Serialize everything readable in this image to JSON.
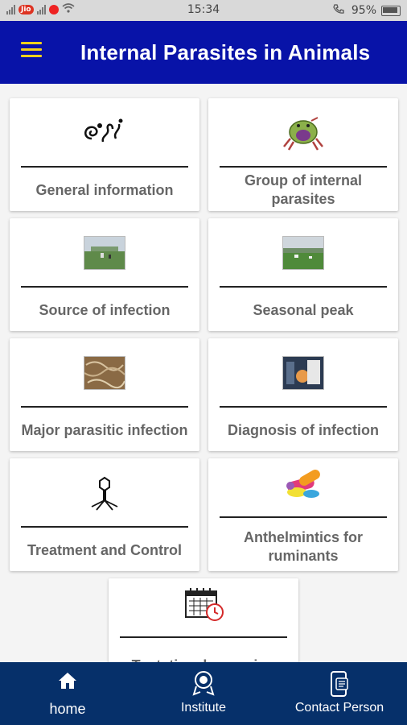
{
  "status_bar": {
    "carrier": "Jio",
    "time": "15:34",
    "battery": "95%"
  },
  "app_bar": {
    "title": "Internal Parasites in Animals",
    "menu_icon": "hamburger-menu-icon"
  },
  "menu": {
    "items": [
      {
        "label": "General information",
        "icon": "parasite-worm-icon"
      },
      {
        "label": "Group of internal parasites",
        "icon": "parasite-creature-icon"
      },
      {
        "label": "Source of infection",
        "icon": "pasture-photo"
      },
      {
        "label": "Seasonal peak",
        "icon": "field-photo"
      },
      {
        "label": "Major parasitic infection",
        "icon": "worms-photo"
      },
      {
        "label": "Diagnosis of infection",
        "icon": "lab-photo"
      },
      {
        "label": "Treatment and Control",
        "icon": "virus-icon"
      },
      {
        "label": "Anthelmintics for ruminants",
        "icon": "pills-icon"
      },
      {
        "label": "Tentative deworming",
        "icon": "calendar-icon"
      }
    ]
  },
  "bottom_nav": {
    "items": [
      {
        "label": "home",
        "icon": "home-icon"
      },
      {
        "label": "Institute",
        "icon": "institute-emblem-icon"
      },
      {
        "label": "Contact Person",
        "icon": "phone-contact-icon"
      }
    ]
  },
  "colors": {
    "app_bar": "#0813a8",
    "menu_icon": "#f3d21b",
    "bottom_nav": "#06306a",
    "label_text": "#666666"
  }
}
